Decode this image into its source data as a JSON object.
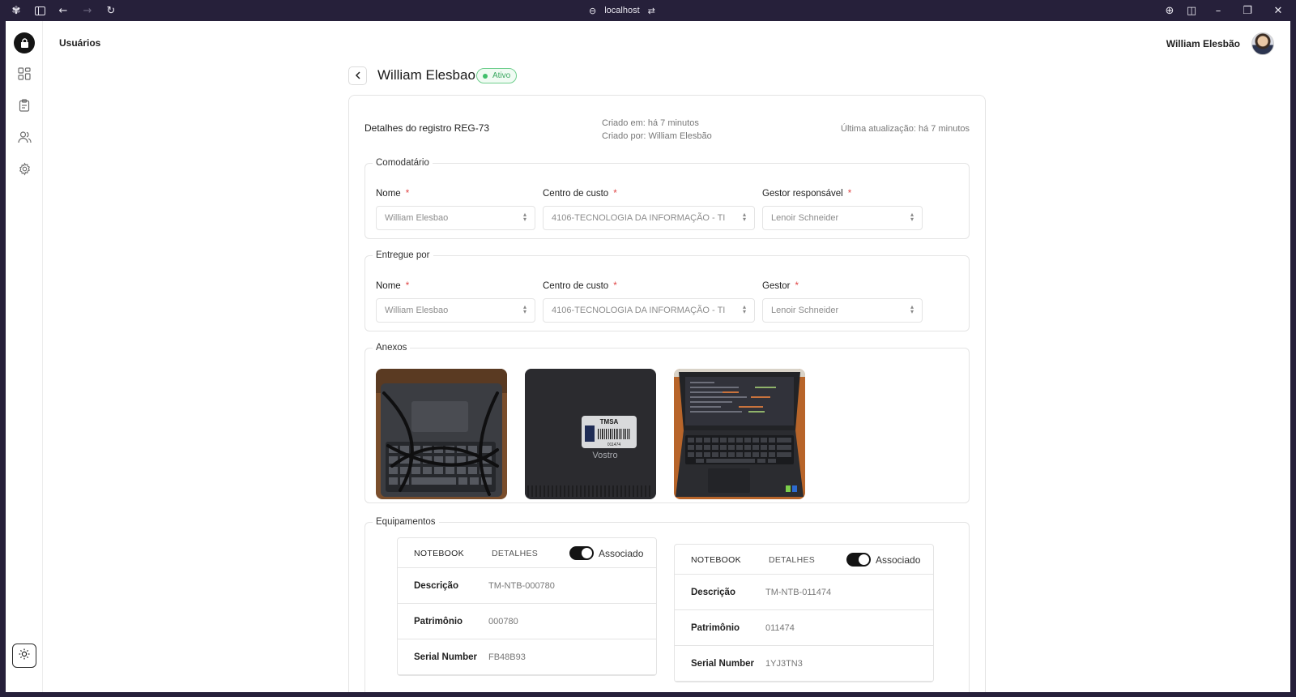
{
  "browser": {
    "url": "localhost"
  },
  "header": {
    "section_title": "Usuários",
    "user_name": "William Elesbão"
  },
  "sidebar": {
    "items": [
      {
        "icon": "dashboard-icon"
      },
      {
        "icon": "clipboard-icon"
      },
      {
        "icon": "users-icon"
      },
      {
        "icon": "gear-icon"
      }
    ],
    "theme_icon": "sun-icon"
  },
  "page": {
    "title": "William Elesbao",
    "status": "Ativo"
  },
  "record": {
    "title": "Detalhes do registro REG-73",
    "created_at": "Criado em: há 7 minutos",
    "created_by": "Criado por: William Elesbão",
    "updated_at": "Última atualização: há 7 minutos"
  },
  "comodatario": {
    "legend": "Comodatário",
    "name_label": "Nome",
    "name_value": "William Elesbao",
    "cost_center_label": "Centro de custo",
    "cost_center_value": "4106-TECNOLOGIA DA INFORMAÇÃO - TI",
    "manager_label": "Gestor responsável",
    "manager_value": "Lenoir Schneider"
  },
  "entregue_por": {
    "legend": "Entregue por",
    "name_label": "Nome",
    "name_value": "William Elesbao",
    "cost_center_label": "Centro de custo",
    "cost_center_value": "4106-TECNOLOGIA DA INFORMAÇÃO - TI",
    "manager_label": "Gestor",
    "manager_value": "Lenoir Schneider"
  },
  "anexos": {
    "legend": "Anexos",
    "photo2_tag_brand": "TMSA",
    "photo2_tag_number": "011474",
    "photo2_model": "Vostro"
  },
  "equipamentos": {
    "legend": "Equipamentos",
    "items": [
      {
        "tab1": "NOTEBOOK",
        "tab2": "DETALHES",
        "toggle_label": "Associado",
        "rows": [
          {
            "key": "Descrição",
            "value": "TM-NTB-000780"
          },
          {
            "key": "Patrimônio",
            "value": "000780"
          },
          {
            "key": "Serial Number",
            "value": "FB48B93"
          }
        ]
      },
      {
        "tab1": "NOTEBOOK",
        "tab2": "DETALHES",
        "toggle_label": "Associado",
        "rows": [
          {
            "key": "Descrição",
            "value": "TM-NTB-011474"
          },
          {
            "key": "Patrimônio",
            "value": "011474"
          },
          {
            "key": "Serial Number",
            "value": "1YJ3TN3"
          }
        ]
      }
    ]
  }
}
